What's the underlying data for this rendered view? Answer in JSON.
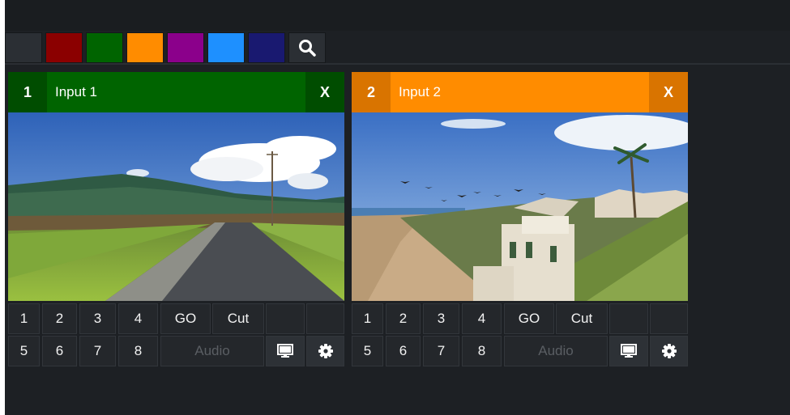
{
  "filter_colors": [
    {
      "name": "none",
      "color": "#2b2f34"
    },
    {
      "name": "red",
      "color": "#8b0000"
    },
    {
      "name": "green",
      "color": "#006400"
    },
    {
      "name": "orange",
      "color": "#ff8c00"
    },
    {
      "name": "purple",
      "color": "#8b008b"
    },
    {
      "name": "blue",
      "color": "#1e90ff"
    },
    {
      "name": "navy",
      "color": "#191970"
    }
  ],
  "search_icon": "search-icon",
  "inputs": [
    {
      "number": "1",
      "title": "Input 1",
      "close_label": "X",
      "header_color": "#006400",
      "badge_color": "#004d00",
      "preview": "road-mountain-scene",
      "buttons_row1": [
        "1",
        "2",
        "3",
        "4",
        "GO",
        "Cut",
        "",
        ""
      ],
      "buttons_row2": [
        "5",
        "6",
        "7",
        "8"
      ],
      "audio_label": "Audio",
      "monitor_icon": "monitor-icon",
      "settings_icon": "gear-icon"
    },
    {
      "number": "2",
      "title": "Input 2",
      "close_label": "X",
      "header_color": "#ff8c00",
      "badge_color": "#d97400",
      "preview": "beach-house-scene",
      "buttons_row1": [
        "1",
        "2",
        "3",
        "4",
        "GO",
        "Cut",
        "",
        ""
      ],
      "buttons_row2": [
        "5",
        "6",
        "7",
        "8"
      ],
      "audio_label": "Audio",
      "monitor_icon": "monitor-icon",
      "settings_icon": "gear-icon"
    }
  ]
}
